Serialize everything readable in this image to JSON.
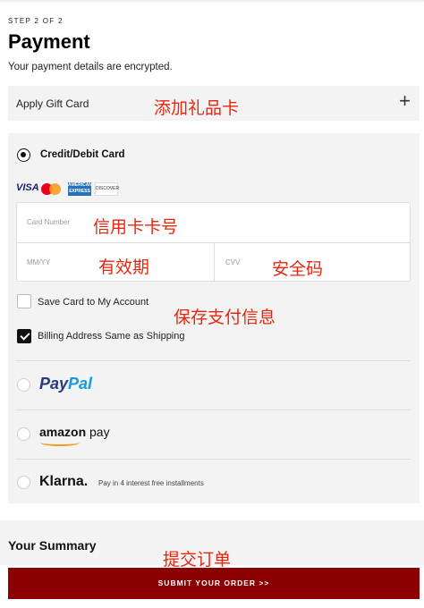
{
  "header": {
    "step": "STEP 2 OF 2",
    "title": "Payment",
    "subtitle": "Your payment details are encrypted."
  },
  "gift_card": {
    "label": "Apply Gift Card",
    "expand_icon": "plus-icon",
    "annotation": "添加礼品卡"
  },
  "credit_card": {
    "label": "Credit/Debit Card",
    "selected": true,
    "logos": [
      "VISA",
      "mastercard",
      "AMERICAN EXPRESS",
      "DISCOVER"
    ],
    "card_number": {
      "placeholder": "Card Number",
      "annotation": "信用卡卡号"
    },
    "expiry": {
      "placeholder": "MM/YY",
      "annotation": "有效期"
    },
    "cvv": {
      "placeholder": "CVV",
      "annotation": "安全码"
    },
    "save_card": {
      "label": "Save Card to My Account",
      "checked": false,
      "annotation": "保存支付信息"
    },
    "billing_same": {
      "label": "Billing Address Same as Shipping",
      "checked": true
    }
  },
  "alt_payments": {
    "paypal": {
      "part1": "Pay",
      "part2": "Pal"
    },
    "amazon": {
      "part1": "amazon",
      "part2": " pay"
    },
    "klarna": {
      "name": "Klarna.",
      "subtitle": "Pay in 4 interest free installments"
    }
  },
  "summary": {
    "title": "Your Summary",
    "annotation": "提交订单"
  },
  "submit": {
    "label": "SUBMIT YOUR ORDER >>"
  },
  "colors": {
    "accent": "#8b0000",
    "annotation": "#e8260f",
    "panel": "#f3f3f3"
  }
}
